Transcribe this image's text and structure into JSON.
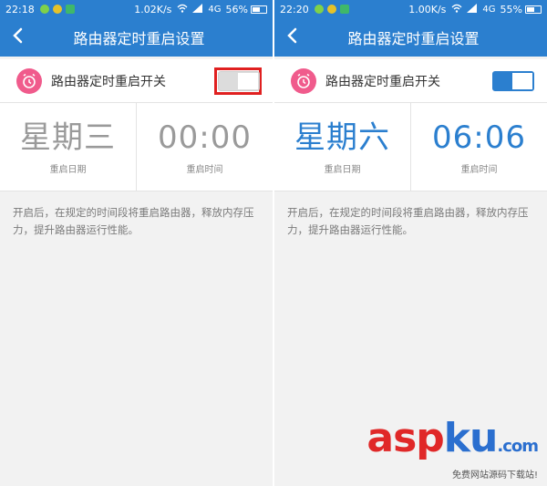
{
  "left": {
    "status": {
      "time": "22:18",
      "speed": "1.02K/s",
      "network": "4G",
      "battery": "56%",
      "battery_level": 0.56
    },
    "title": "路由器定时重启设置",
    "switch_label": "路由器定时重启开关",
    "switch_on": false,
    "day_value": "星期三",
    "day_caption": "重启日期",
    "time_value": "00:00",
    "time_caption": "重启时间",
    "description": "开启后，在规定的时间段将重启路由器，释放内存压力，提升路由器运行性能。"
  },
  "right": {
    "status": {
      "time": "22:20",
      "speed": "1.00K/s",
      "network": "4G",
      "battery": "55%",
      "battery_level": 0.55
    },
    "title": "路由器定时重启设置",
    "switch_label": "路由器定时重启开关",
    "switch_on": true,
    "day_value": "星期六",
    "day_caption": "重启日期",
    "time_value": "06:06",
    "time_caption": "重启时间",
    "description": "开启后，在规定的时间段将重启路由器，释放内存压力，提升路由器运行性能。"
  },
  "watermark": {
    "main_a": "asp",
    "main_b": "ku",
    "suffix": ".com",
    "sub": "免费网站源码下载站!"
  },
  "colors": {
    "accent": "#2b7fcf",
    "clock_badge": "#f05b8c",
    "highlight_frame": "#e02020"
  },
  "icons": {
    "back": "chevron-left-icon",
    "alarm": "alarm-clock-icon",
    "wifi": "wifi-icon",
    "signal": "signal-icon",
    "battery": "battery-icon"
  }
}
